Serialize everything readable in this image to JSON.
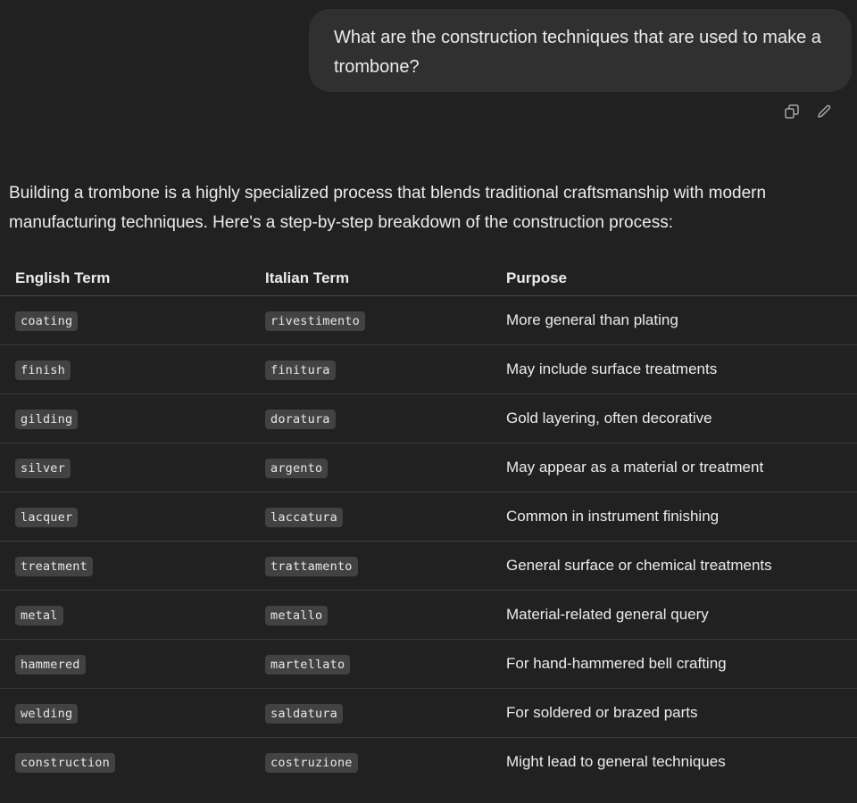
{
  "user_message": {
    "text": "What are the construction techniques that are used to make a trombone?"
  },
  "message_actions": [
    {
      "icon": "copy-icon",
      "label": ""
    },
    {
      "icon": "edit-icon",
      "label": ""
    }
  ],
  "assistant_message": {
    "intro": "Building a trombone is a highly specialized process that blends traditional craftsmanship with modern manufacturing techniques. Here's a step-by-step breakdown of the construction process:"
  },
  "table": {
    "headers": [
      "English Term",
      "Italian Term",
      "Purpose"
    ],
    "rows": [
      {
        "english": "coating",
        "italian": "rivestimento",
        "purpose": "More general than plating"
      },
      {
        "english": "finish",
        "italian": "finitura",
        "purpose": "May include surface treatments"
      },
      {
        "english": "gilding",
        "italian": "doratura",
        "purpose": "Gold layering, often decorative"
      },
      {
        "english": "silver",
        "italian": "argento",
        "purpose": "May appear as a material or treatment"
      },
      {
        "english": "lacquer",
        "italian": "laccatura",
        "purpose": "Common in instrument finishing"
      },
      {
        "english": "treatment",
        "italian": "trattamento",
        "purpose": "General surface or chemical treatments"
      },
      {
        "english": "metal",
        "italian": "metallo",
        "purpose": "Material-related general query"
      },
      {
        "english": "hammered",
        "italian": "martellato",
        "purpose": "For hand-hammered bell crafting"
      },
      {
        "english": "welding",
        "italian": "saldatura",
        "purpose": "For soldered or brazed parts"
      },
      {
        "english": "construction",
        "italian": "costruzione",
        "purpose": "Might lead to general techniques"
      }
    ]
  }
}
